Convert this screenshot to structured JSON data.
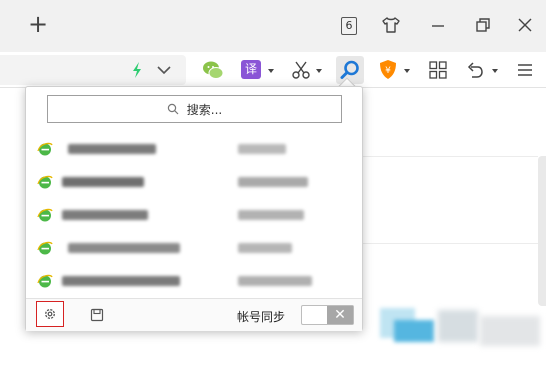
{
  "titlebar": {
    "new_tab_label": "+",
    "tab_count": "6",
    "icons": [
      "plus-icon",
      "tab-count-icon",
      "tshirt-skin-icon",
      "minimize-icon",
      "restore-icon",
      "close-icon"
    ]
  },
  "toolbar": {
    "icons": [
      "lightning-icon",
      "chevron-down-icon",
      "wechat-icon",
      "translate-icon",
      "scissors-icon",
      "search-icon",
      "shield-icon",
      "grid-apps-icon",
      "undo-icon",
      "menu-icon"
    ],
    "translate_glyph": "译",
    "accent_green": "#2ecc71",
    "translate_purple": "#8a55d6",
    "search_blue": "#1e78d6",
    "shield_orange": "#ff8a00"
  },
  "popup": {
    "search_placeholder": "搜索...",
    "items": [
      {
        "icon": "ie-icon"
      },
      {
        "icon": "ie-icon"
      },
      {
        "icon": "ie-icon"
      },
      {
        "icon": "ie-icon"
      },
      {
        "icon": "ie-icon"
      }
    ],
    "footer": {
      "settings_icon": "gear-icon",
      "save_icon": "save-icon",
      "sync_label": "帐号同步",
      "toggle_off_glyph": "✕"
    }
  }
}
